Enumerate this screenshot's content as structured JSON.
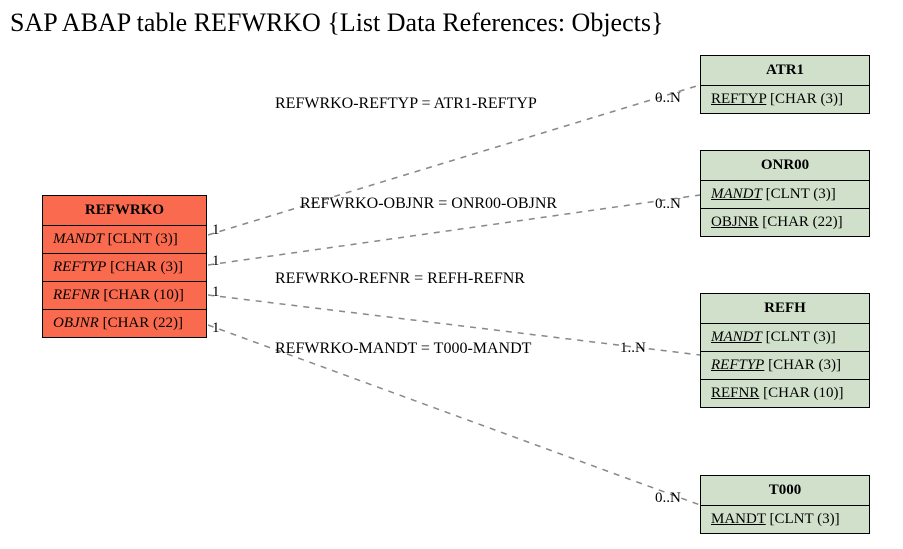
{
  "title": "SAP ABAP table REFWRKO {List Data References: Objects}",
  "main_entity": {
    "name": "REFWRKO",
    "fields": [
      {
        "name": "MANDT",
        "type": "[CLNT (3)]",
        "italic": true
      },
      {
        "name": "REFTYP",
        "type": "[CHAR (3)]",
        "italic": true
      },
      {
        "name": "REFNR",
        "type": "[CHAR (10)]",
        "italic": true
      },
      {
        "name": "OBJNR",
        "type": "[CHAR (22)]",
        "italic": true
      }
    ]
  },
  "related_entities": [
    {
      "name": "ATR1",
      "fields": [
        {
          "name": "REFTYP",
          "type": "[CHAR (3)]",
          "underline": true
        }
      ]
    },
    {
      "name": "ONR00",
      "fields": [
        {
          "name": "MANDT",
          "type": "[CLNT (3)]",
          "italic": true,
          "underline": true
        },
        {
          "name": "OBJNR",
          "type": "[CHAR (22)]",
          "underline": true
        }
      ]
    },
    {
      "name": "REFH",
      "fields": [
        {
          "name": "MANDT",
          "type": "[CLNT (3)]",
          "italic": true,
          "underline": true
        },
        {
          "name": "REFTYP",
          "type": "[CHAR (3)]",
          "italic": true,
          "underline": true
        },
        {
          "name": "REFNR",
          "type": "[CHAR (10)]",
          "underline": true
        }
      ]
    },
    {
      "name": "T000",
      "fields": [
        {
          "name": "MANDT",
          "type": "[CLNT (3)]",
          "underline": true
        }
      ]
    }
  ],
  "relations": [
    {
      "label": "REFWRKO-REFTYP = ATR1-REFTYP",
      "left_card": "1",
      "right_card": "0..N"
    },
    {
      "label": "REFWRKO-OBJNR = ONR00-OBJNR",
      "left_card": "1",
      "right_card": "0..N"
    },
    {
      "label": "REFWRKO-REFNR = REFH-REFNR",
      "left_card": "1",
      "right_card": "1..N"
    },
    {
      "label": "REFWRKO-MANDT = T000-MANDT",
      "left_card": "1",
      "right_card": "0..N"
    }
  ],
  "chart_data": {
    "type": "diagram",
    "title": "SAP ABAP table REFWRKO {List Data References: Objects}",
    "entities": [
      {
        "name": "REFWRKO",
        "role": "main",
        "fields": [
          "MANDT [CLNT (3)]",
          "REFTYP [CHAR (3)]",
          "REFNR [CHAR (10)]",
          "OBJNR [CHAR (22)]"
        ]
      },
      {
        "name": "ATR1",
        "role": "ref",
        "fields": [
          "REFTYP [CHAR (3)]"
        ]
      },
      {
        "name": "ONR00",
        "role": "ref",
        "fields": [
          "MANDT [CLNT (3)]",
          "OBJNR [CHAR (22)]"
        ]
      },
      {
        "name": "REFH",
        "role": "ref",
        "fields": [
          "MANDT [CLNT (3)]",
          "REFTYP [CHAR (3)]",
          "REFNR [CHAR (10)]"
        ]
      },
      {
        "name": "T000",
        "role": "ref",
        "fields": [
          "MANDT [CLNT (3)]"
        ]
      }
    ],
    "edges": [
      {
        "from": "REFWRKO",
        "to": "ATR1",
        "join": "REFWRKO-REFTYP = ATR1-REFTYP",
        "card_from": "1",
        "card_to": "0..N"
      },
      {
        "from": "REFWRKO",
        "to": "ONR00",
        "join": "REFWRKO-OBJNR = ONR00-OBJNR",
        "card_from": "1",
        "card_to": "0..N"
      },
      {
        "from": "REFWRKO",
        "to": "REFH",
        "join": "REFWRKO-REFNR = REFH-REFNR",
        "card_from": "1",
        "card_to": "1..N"
      },
      {
        "from": "REFWRKO",
        "to": "T000",
        "join": "REFWRKO-MANDT = T000-MANDT",
        "card_from": "1",
        "card_to": "0..N"
      }
    ]
  }
}
